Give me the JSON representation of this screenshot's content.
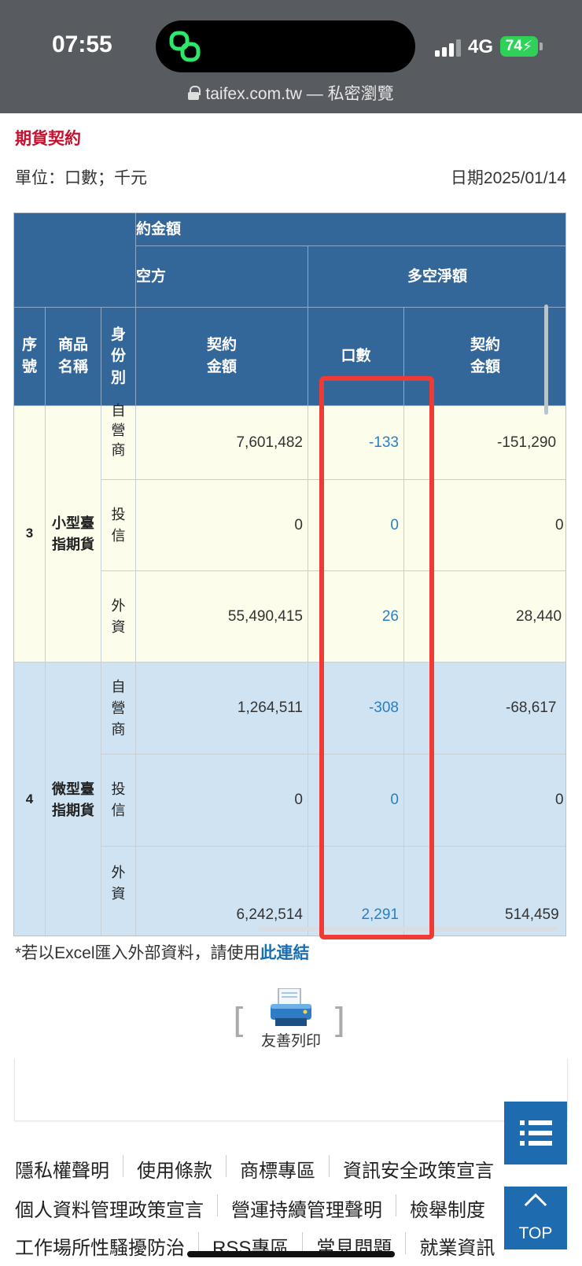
{
  "status_bar": {
    "time": "07:55",
    "network": "4G",
    "battery": "74",
    "url_text": "taifex.com.tw — 私密瀏覽"
  },
  "page": {
    "title": "期貨契約",
    "unit": "單位：口數；千元",
    "date": "日期2025/01/14"
  },
  "table": {
    "headers": {
      "group_amount": "約金額",
      "sub_short": "空方",
      "sub_net": "多空淨額",
      "col_seq": "序\n號",
      "col_name": "商品\n名稱",
      "col_role": "身\n份\n別",
      "col_short_amount": "契約\n金額",
      "col_net_qty": "口數",
      "col_net_amount": "契約\n金額"
    },
    "groups": [
      {
        "seq": "3",
        "name": "小型臺\n指期貨",
        "rows": [
          {
            "role": "自\n營\n商",
            "short_amount": "7,601,482",
            "net_qty": "-133",
            "net_amount": "-151,290"
          },
          {
            "role": "投\n信",
            "short_amount": "0",
            "net_qty": "0",
            "net_amount": "0"
          },
          {
            "role": "外\n資",
            "short_amount": "55,490,415",
            "net_qty": "26",
            "net_amount": "28,440"
          }
        ]
      },
      {
        "seq": "4",
        "name": "微型臺\n指期貨",
        "rows": [
          {
            "role": "自\n營\n商",
            "short_amount": "1,264,511",
            "net_qty": "-308",
            "net_amount": "-68,617"
          },
          {
            "role": "投\n信",
            "short_amount": "0",
            "net_qty": "0",
            "net_amount": "0"
          },
          {
            "role": "外\n資",
            "short_amount": "6,242,514",
            "net_qty": "2,291",
            "net_amount": "514,459"
          }
        ]
      }
    ]
  },
  "excel_note": {
    "prefix": "*若以Excel匯入外部資料，請使用",
    "link": "此連結"
  },
  "print": {
    "label": "友善列印"
  },
  "footer": {
    "row1": [
      "隱私權聲明",
      "使用條款",
      "商標專區",
      "資訊安全政策宣言"
    ],
    "row2": [
      "個人資料管理政策宣言",
      "營運持續管理聲明",
      "檢舉制度"
    ],
    "row3": [
      "工作場所性騷擾防治",
      "RSS專區",
      "常見問題",
      "就業資訊"
    ]
  },
  "fab": {
    "top_label": "TOP"
  },
  "colors": {
    "header_blue": "#336699",
    "row_yellow": "#fdfdec",
    "row_blue": "#cfe3f3",
    "title_red": "#c8102e",
    "highlight_red": "#ee3b36",
    "link_blue": "#2b7fc0",
    "fab_blue": "#1f6bb0"
  },
  "icons": [
    "lock-icon",
    "printer-icon",
    "list-menu-icon",
    "chevron-up-icon",
    "signal-icon",
    "link-icon"
  ]
}
